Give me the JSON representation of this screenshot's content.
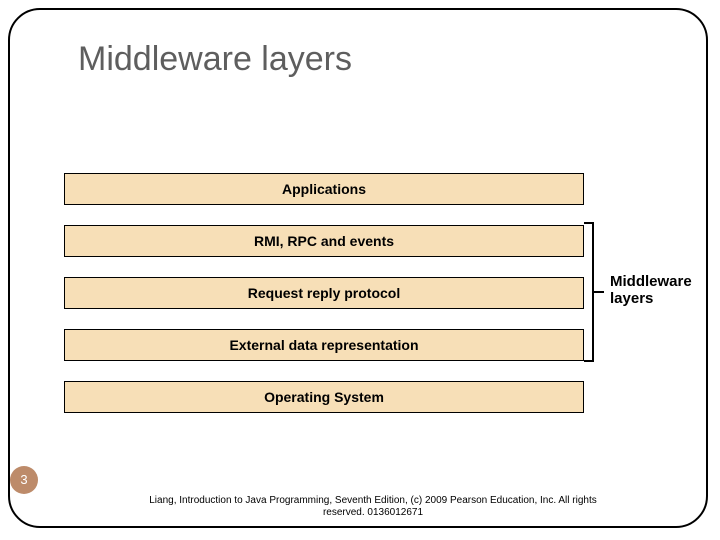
{
  "title": "Middleware layers",
  "layers": {
    "applications": "Applications",
    "rmi": "RMI, RPC and events",
    "rrp": "Request reply protocol",
    "edr": "External data representation",
    "os": "Operating System"
  },
  "bracket_label_line1": "Middleware",
  "bracket_label_line2": "layers",
  "page_number": "3",
  "footer": "Liang, Introduction to Java Programming, Seventh Edition, (c) 2009 Pearson Education, Inc. All rights reserved. 0136012671",
  "colors": {
    "layer_fill": "#f7dfb7",
    "title_text": "#5e5e5e",
    "page_circle": "#bd8b6a"
  }
}
